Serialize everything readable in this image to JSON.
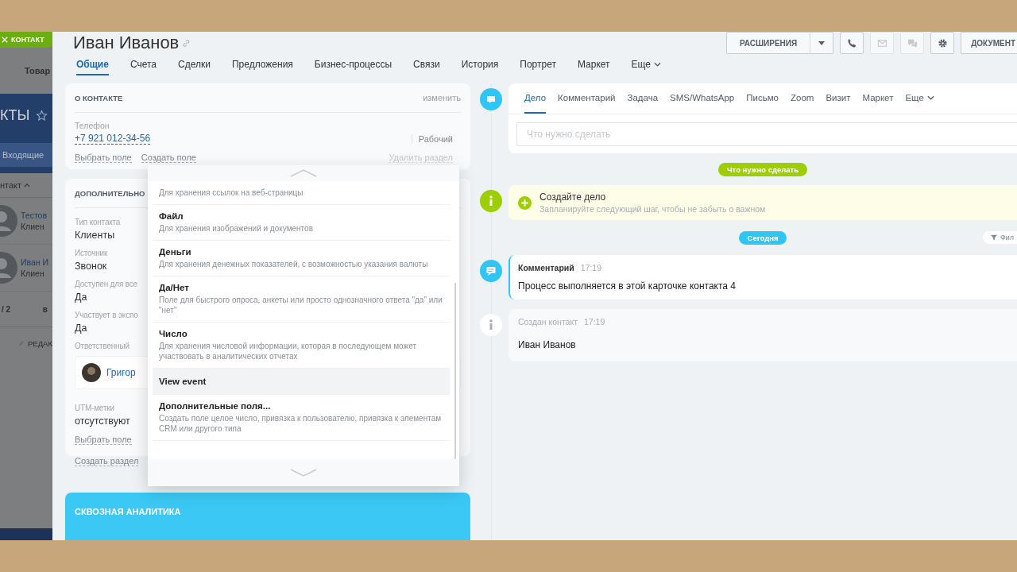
{
  "background_page": {
    "close_button": "КОНТАКТ",
    "menu_item": "Товар",
    "section_title": "КТЫ",
    "filter_chip": "Входящие",
    "column_header": "нтакт",
    "contacts": [
      {
        "name": "Тестов",
        "type": "Клиен"
      },
      {
        "name": "Иван И",
        "type": "Клиен"
      }
    ],
    "counter": "/ 2",
    "column_label": "в",
    "edit_button": "РЕДАК"
  },
  "header": {
    "title": "Иван Иванов",
    "extensions_button": "РАСШИРЕНИЯ",
    "action_buttons": [
      {
        "kind": "phone",
        "disabled": false
      },
      {
        "kind": "mail",
        "disabled": true
      },
      {
        "kind": "chat",
        "disabled": true
      },
      {
        "kind": "settings",
        "disabled": false
      }
    ],
    "documents_button": "ДОКУМЕНТ"
  },
  "tabs": [
    {
      "label": "Общие",
      "selected": true,
      "dropdown": false
    },
    {
      "label": "Счета",
      "selected": false,
      "dropdown": false
    },
    {
      "label": "Сделки",
      "selected": false,
      "dropdown": false
    },
    {
      "label": "Предложения",
      "selected": false,
      "dropdown": false
    },
    {
      "label": "Бизнес-процессы",
      "selected": false,
      "dropdown": false
    },
    {
      "label": "Связи",
      "selected": false,
      "dropdown": false
    },
    {
      "label": "История",
      "selected": false,
      "dropdown": false
    },
    {
      "label": "Портрет",
      "selected": false,
      "dropdown": false
    },
    {
      "label": "Маркет",
      "selected": false,
      "dropdown": false
    },
    {
      "label": "Еще",
      "selected": false,
      "dropdown": true
    }
  ],
  "contact_card": {
    "title": "О КОНТАКТЕ",
    "edit_link": "изменить",
    "field_label": "Телефон",
    "phone": "+7 921 012-34-56",
    "phone_type": "Рабочий",
    "links": [
      "Выбрать поле",
      "Создать поле"
    ],
    "delete_link": "Удалить раздел"
  },
  "extra_card": {
    "title": "ДОПОЛНИТЕЛЬНО",
    "fields": [
      {
        "kind": "text",
        "label": "Тип контакта",
        "value": "Клиенты"
      },
      {
        "kind": "text",
        "label": "Источник",
        "value": "Звонок"
      },
      {
        "kind": "text",
        "label": "Доступен для все",
        "value": "Да"
      },
      {
        "kind": "text",
        "label": "Участвует в экспо",
        "value": "Да"
      },
      {
        "kind": "user",
        "label": "Ответственный",
        "value": "Григор"
      },
      {
        "kind": "text",
        "label": "UTM-метки",
        "value": "отсутствуют"
      }
    ],
    "link": "Выбрать поле"
  },
  "create_section_link": "Создать раздел",
  "analytics_card": {
    "title": "СКВОЗНАЯ АНАЛИТИКА"
  },
  "field_type_menu": {
    "items": [
      {
        "description": "Для хранения ссылок на веб-страницы",
        "hovered": false
      },
      {
        "title": "Файл",
        "description": "Для хранения изображений и документов",
        "hovered": false
      },
      {
        "title": "Деньги",
        "description": "Для хранения денежных показателей, с возможностью указания валюты",
        "hovered": false
      },
      {
        "title": "Да/Нет",
        "description": "Поле для быстрого опроса, анкеты или просто однозначного ответа \"да\" или \"нет\"",
        "hovered": false
      },
      {
        "title": "Число",
        "description": "Для хранения числовой информации, которая в последующем может участвовать в аналитических отчетах",
        "hovered": false
      },
      {
        "title": "View event",
        "hovered": true
      },
      {
        "title": "Дополнительные поля...",
        "description": "Создать поле целое число, привязка к пользователю, привязка к элементам CRM или другого типа",
        "hovered": false
      }
    ]
  },
  "timeline": {
    "editor_tabs": [
      {
        "label": "Дело",
        "selected": true,
        "dropdown": false
      },
      {
        "label": "Комментарий",
        "selected": false,
        "dropdown": false
      },
      {
        "label": "Задача",
        "selected": false,
        "dropdown": false
      },
      {
        "label": "SMS/WhatsApp",
        "selected": false,
        "dropdown": false
      },
      {
        "label": "Письмо",
        "selected": false,
        "dropdown": false
      },
      {
        "label": "Zoom",
        "selected": false,
        "dropdown": false
      },
      {
        "label": "Визит",
        "selected": false,
        "dropdown": false
      },
      {
        "label": "Маркет",
        "selected": false,
        "dropdown": false
      },
      {
        "label": "Еще",
        "selected": false,
        "dropdown": true
      }
    ],
    "placeholder": "Что нужно сделать",
    "planned_badge": "Что нужно сделать",
    "create_task": {
      "title": "Создайте дело",
      "hint": "Запланируйте следующий шаг, чтобы не забыть о важном"
    },
    "today_badge": "Сегодня",
    "filter_button": "Фил",
    "events": [
      {
        "kind": "comment",
        "title": "Комментарий",
        "time": "17:19",
        "text": "Процесс выполняется в этой карточке контакта 4"
      },
      {
        "kind": "info",
        "title": "Создан контакт",
        "time": "17:19",
        "text": "Иван Иванов"
      }
    ]
  }
}
